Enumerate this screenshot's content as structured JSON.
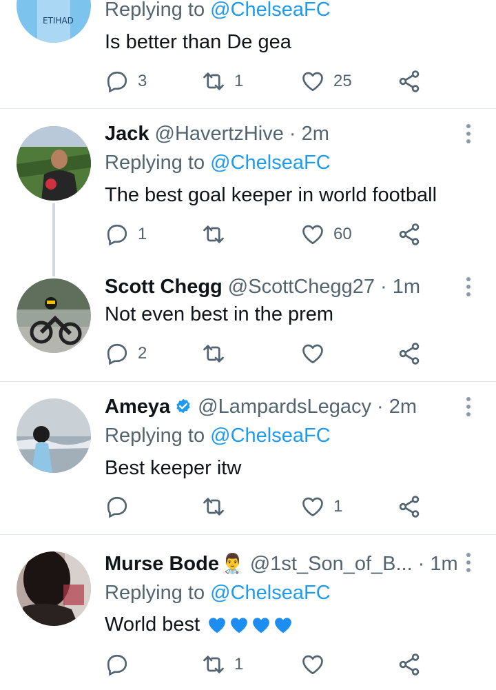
{
  "tweets": [
    {
      "id": "t0",
      "reply_label": "Replying to",
      "reply_handle": "@ChelseaFC",
      "text": "Is better than De gea",
      "reply_count": "3",
      "retweet_count": "1",
      "like_count": "25"
    },
    {
      "id": "t1",
      "name": "Jack",
      "handle": "@HavertzHive",
      "sep": "·",
      "time": "2m",
      "reply_label": "Replying to",
      "reply_handle": "@ChelseaFC",
      "text": "The best goal keeper in world football",
      "reply_count": "1",
      "retweet_count": "",
      "like_count": "60"
    },
    {
      "id": "t2",
      "name": "Scott Chegg",
      "handle": "@ScottChegg27",
      "sep": "·",
      "time": "1m",
      "text": "Not even best in the prem",
      "reply_count": "2",
      "retweet_count": "",
      "like_count": ""
    },
    {
      "id": "t3",
      "name": "Ameya",
      "verified": true,
      "handle": "@LampardsLegacy",
      "sep": "·",
      "time": "2m",
      "reply_label": "Replying to",
      "reply_handle": "@ChelseaFC",
      "text": "Best keeper itw",
      "reply_count": "",
      "retweet_count": "",
      "like_count": "1"
    },
    {
      "id": "t4",
      "name": "Murse Bode",
      "name_emoji": "👨‍⚕️",
      "handle": "@1st_Son_of_B...",
      "sep": "·",
      "time": "1m",
      "reply_label": "Replying to",
      "reply_handle": "@ChelseaFC",
      "text": "World best",
      "text_emoji": "blue-heart x4",
      "reply_count": "",
      "retweet_count": "1",
      "like_count": ""
    }
  ],
  "icons": {
    "reply": "reply-icon",
    "retweet": "retweet-icon",
    "like": "heart-icon",
    "share": "share-icon",
    "more": "more-icon"
  },
  "colors": {
    "link": "#1d9bf0",
    "secondary": "#536471",
    "text": "#0f1419",
    "thread_line": "#cfd9de",
    "blue_heart": "#1d8df0"
  }
}
